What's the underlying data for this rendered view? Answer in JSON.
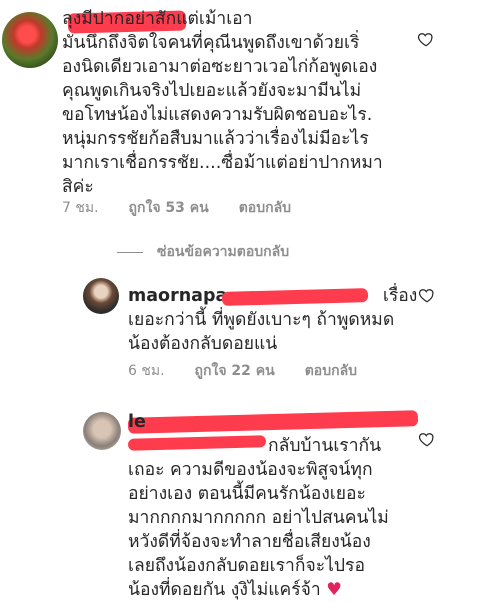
{
  "comments": [
    {
      "username": "",
      "text": "ลุงมีปากอย่าสักแต่เม้าเอา\nมันนึกถึงจิตใจคนที่คุณีนพูดถึงเขาด้วยเริ่\nองนิดเดียวเอามาต่อซะยาวเวอไก่ก้อพูดเอง\nคุณพูดเกินจริงไปเยอะแล้วยังจะมามีนไม่\nขอโทษน้องไม่แสดงความรับผิดชอบอะไร.\nหนุ่มกรรชัยก้อสืบมาแล้วว่าเรื่องไม่มีอะไร\nมากเราเชื่อกรรชัย....ซื่อม้าแต่อย่าปากหมา\nสิค่ะ",
      "time": "7 ชม.",
      "likes": "ถูกใจ 53 คน",
      "reply": "ตอบกลับ"
    },
    {
      "username": "maornapa",
      "text": "เรื่อง\nเยอะกว่านี้ ที่พูดยังเบาะๆ ถ้าพูดหมด\nน้องต้องกลับดอยแน่",
      "time": "6 ชม.",
      "likes": "ถูกใจ 22 คน",
      "reply": "ตอบกลับ"
    },
    {
      "username": "le",
      "text": "กลับบ้านเรากัน\nเถอะ ความดีของน้องจะพิสูจน์ทุก\nอย่างเอง ตอนนี้มีคนรักน้องเยอะ\nมากกกกมากกกกก อย่าไปสนคนไม่\nหวังดีที่จ้องจะทำลายชื่อเสียงน้อง\nเลยถึงน้องกลับดอยเราก็จะไปรอ\nน้องที่ดอยกัน งุงิไม่แคร์จ้า",
      "emoji": "♥"
    }
  ],
  "hide_replies": "ซ่อนข้อความตอบกลับ",
  "icons": {
    "like": "heart-outline-icon"
  },
  "colors": {
    "redaction": "#ff3b4e",
    "meta": "#8e8e8e",
    "emoji_heart": "#e0245e"
  }
}
